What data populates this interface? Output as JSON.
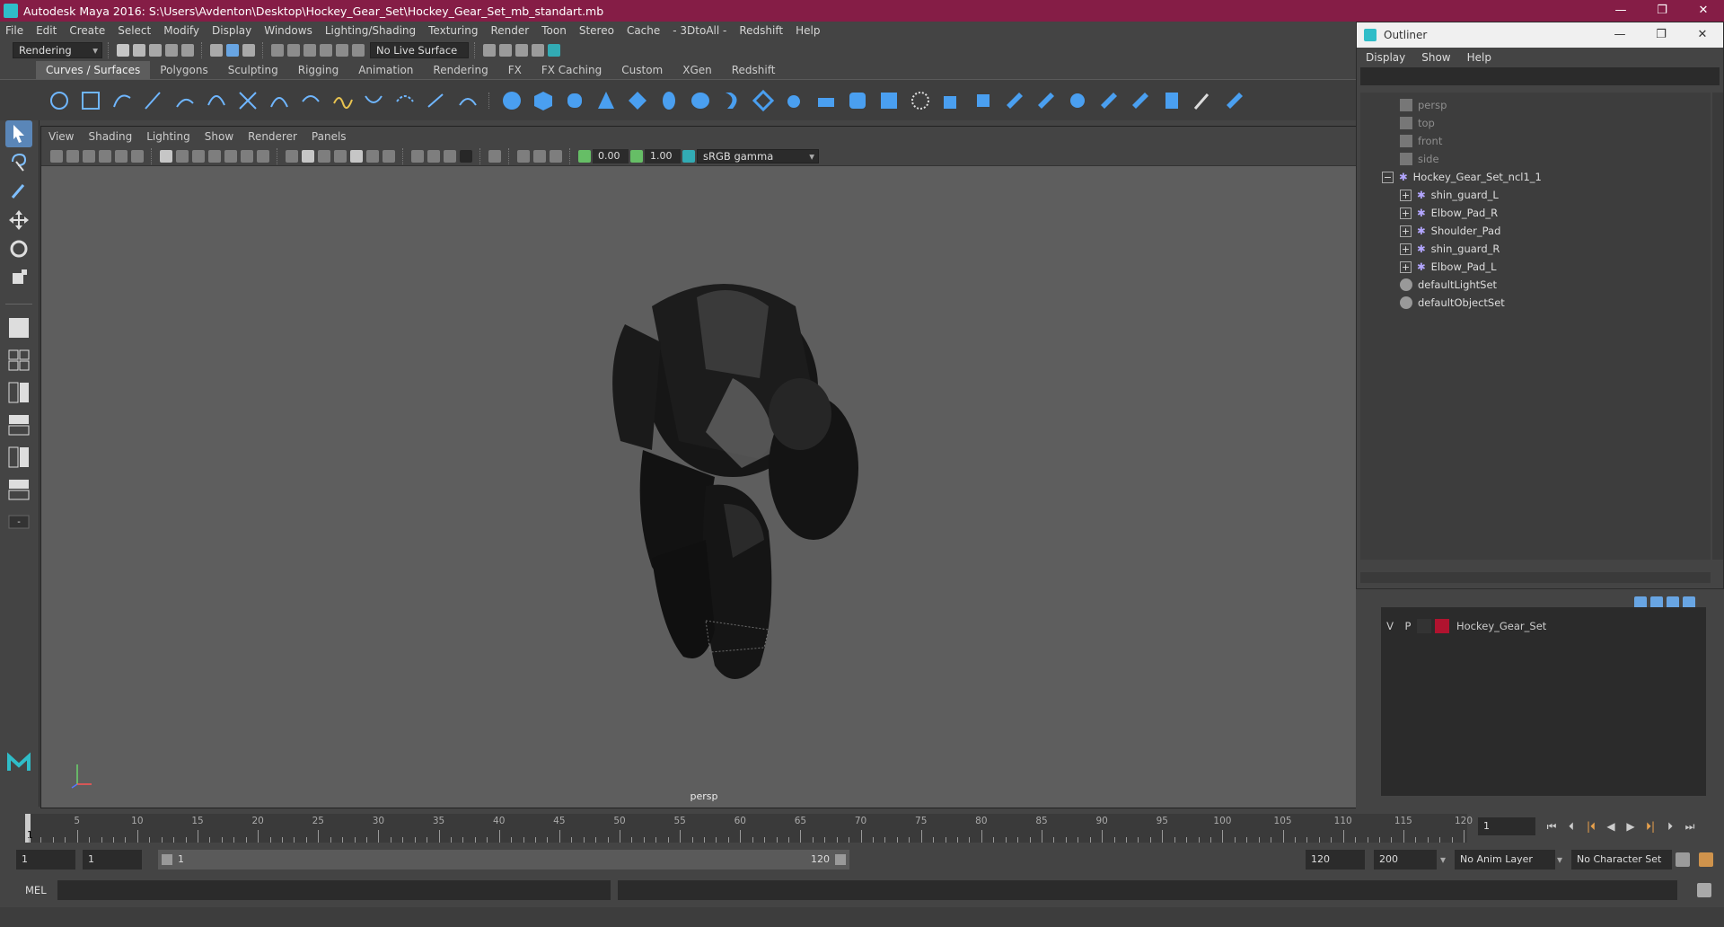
{
  "window": {
    "title": "Autodesk Maya 2016: S:\\Users\\Avdenton\\Desktop\\Hockey_Gear_Set\\Hockey_Gear_Set_mb_standart.mb",
    "controls": [
      "—",
      "❐",
      "✕"
    ]
  },
  "menubar": [
    "File",
    "Edit",
    "Create",
    "Select",
    "Modify",
    "Display",
    "Windows",
    "Lighting/Shading",
    "Texturing",
    "Render",
    "Toon",
    "Stereo",
    "Cache",
    "- 3DtoAll -",
    "Redshift",
    "Help"
  ],
  "statusline": {
    "mode": "Rendering",
    "live_surface": "No Live Surface"
  },
  "shelf_tabs": {
    "active": "Curves / Surfaces",
    "items": [
      "Curves / Surfaces",
      "Polygons",
      "Sculpting",
      "Rigging",
      "Animation",
      "Rendering",
      "FX",
      "FX Caching",
      "Custom",
      "XGen",
      "Redshift"
    ]
  },
  "viewport": {
    "menu": [
      "View",
      "Shading",
      "Lighting",
      "Show",
      "Renderer",
      "Panels"
    ],
    "exposure": "0.00",
    "gamma": "1.00",
    "color_space": "sRGB gamma",
    "camera_label": "persp"
  },
  "outliner": {
    "title": "Outliner",
    "menu": [
      "Display",
      "Show",
      "Help"
    ],
    "cameras": [
      "persp",
      "top",
      "front",
      "side"
    ],
    "group": "Hockey_Gear_Set_ncl1_1",
    "children": [
      "shin_guard_L",
      "Elbow_Pad_R",
      "Shoulder_Pad",
      "shin_guard_R",
      "Elbow_Pad_L"
    ],
    "sets": [
      "defaultLightSet",
      "defaultObjectSet"
    ]
  },
  "layers": {
    "visible_flag": "V",
    "playback_flag": "P",
    "layer_name": "Hockey_Gear_Set",
    "layer_color": "#b0132f"
  },
  "timeline": {
    "ticks": [
      "5",
      "10",
      "15",
      "20",
      "25",
      "30",
      "35",
      "40",
      "45",
      "50",
      "55",
      "60",
      "65",
      "70",
      "75",
      "80",
      "85",
      "90",
      "95",
      "100",
      "105",
      "110",
      "115",
      "120"
    ],
    "current_marker": "1",
    "current_frame": "1"
  },
  "range": {
    "start": "1",
    "start_inner": "1",
    "slider_start": "1",
    "slider_end": "120",
    "end_inner": "120",
    "end": "200",
    "anim_layer": "No Anim Layer",
    "character_set": "No Character Set"
  },
  "cmdline": {
    "lang": "MEL"
  },
  "colors": {
    "title_bar": "#851d46",
    "viewport_bg": "#5e5e5e",
    "accent_cyan": "#2fbdc8",
    "ui_bg": "#444444"
  }
}
